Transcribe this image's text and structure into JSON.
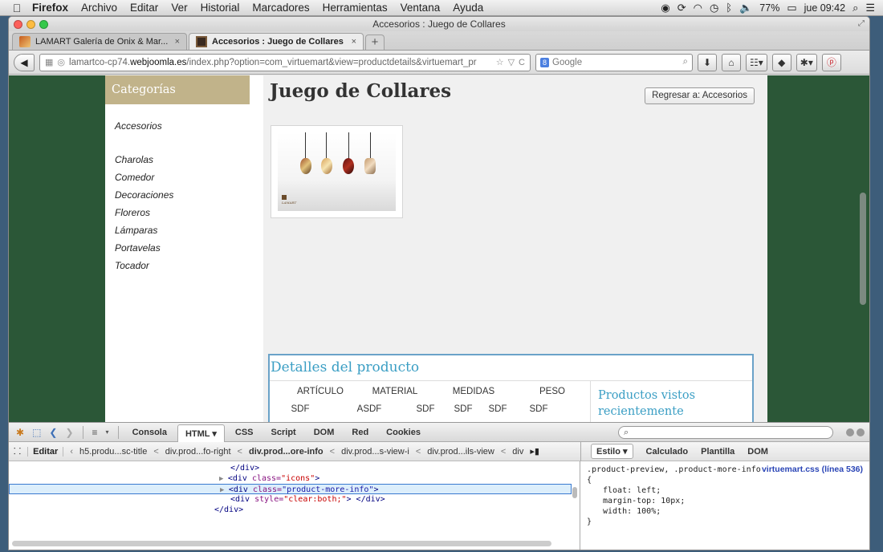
{
  "menubar": {
    "app": "Firefox",
    "items": [
      "Archivo",
      "Editar",
      "Ver",
      "Historial",
      "Marcadores",
      "Herramientas",
      "Ventana",
      "Ayuda"
    ],
    "battery": "77%",
    "clock": "jue 09:42"
  },
  "window": {
    "title": "Accesorios : Juego de Collares"
  },
  "tabs": [
    {
      "title": "LAMART Galería de Onix & Mar...",
      "close": "×"
    },
    {
      "title": "Accesorios : Juego de Collares",
      "close": "×"
    }
  ],
  "newtab": "+",
  "nav": {
    "url_pre": "lamartco-cp74.",
    "url_domain": "webjoomla.es",
    "url_post": "/index.php?option=com_virtuemart&view=productdetails&virtuemart_pr",
    "search_engine": "8",
    "search_placeholder": "Google"
  },
  "site": {
    "categories_title": "Categorías",
    "categories": [
      "Accesorios",
      "Charolas",
      "Comedor",
      "Decoraciones",
      "Floreros",
      "Lámparas",
      "Portavelas",
      "Tocador"
    ],
    "product_title": "Juego de Collares",
    "back_button": "Regresar a: Accesorios",
    "image_logo": "LAMART",
    "details_title": "Detalles del producto",
    "details_headers": [
      "ARTÍCULO",
      "MATERIAL",
      "MEDIDAS",
      "PESO"
    ],
    "details_values": [
      "SDF",
      "ASDF",
      "SDF",
      "SDF",
      "SDF",
      "SDF"
    ],
    "recent_title": "Productos vistos recientemente"
  },
  "firebug": {
    "tabs": [
      "Consola",
      "HTML ▾",
      "CSS",
      "Script",
      "DOM",
      "Red",
      "Cookies"
    ],
    "edit": "Editar",
    "breadcrumbs": [
      "h5.produ...sc-title",
      "div.prod...fo-right",
      "div.prod...ore-info",
      "div.prod...s-view-i",
      "div.prod...ils-view",
      "div"
    ],
    "side_tabs": [
      "Estilo ▾",
      "Calculado",
      "Plantilla",
      "DOM"
    ],
    "html_lines": {
      "l1": "</div>",
      "l2_tag": "<div ",
      "l2_attr": "class=",
      "l2_val": "\"icons\"",
      "l2_end": ">",
      "l3_tag": "<div ",
      "l3_attr": "class=",
      "l3_val": "\"product-more-info\"",
      "l3_end": ">",
      "l4_tag": "<div ",
      "l4_attr": "style=",
      "l4_val": "\"clear:both;\"",
      "l4_end": "> </div>",
      "l5": "</div>"
    },
    "css": {
      "selector": ".product-preview, .product-more-info",
      "source": "virtuemart.css (línea 536)",
      "open": "{",
      "props": [
        "float: left;",
        "margin-top: 10px;",
        "width: 100%;"
      ],
      "close": "}"
    }
  }
}
